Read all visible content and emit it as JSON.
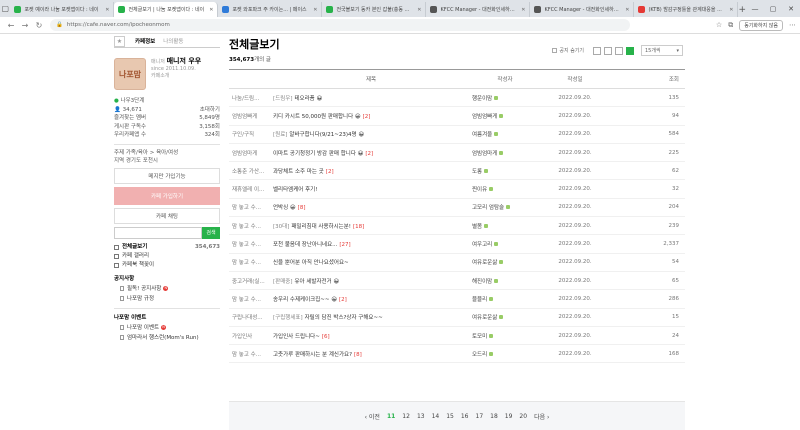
{
  "browser": {
    "tabs": [
      {
        "title": "포켓 예이라 나눔 포켓앱이다 : 네이",
        "color": "#27b24a",
        "active": false
      },
      {
        "title": "전체글보기 | 나눔 포켓앱이다 : 네이",
        "color": "#27b24a",
        "active": true
      },
      {
        "title": "포켓 와포파크 주 카이는... | 페이스",
        "color": "#2f7bd9",
        "active": false
      },
      {
        "title": "전국볼보기 동카 본인 갑불(충동 ...",
        "color": "#27b24a",
        "active": false
      },
      {
        "title": "KFCC Manager - 대전화인세하기 ...",
        "color": "#555555",
        "active": false
      },
      {
        "title": "KFCC Manager - 대전화인세하기 ...",
        "color": "#555555",
        "active": false
      },
      {
        "title": "(KTB) 밤감구정틀을 관계대응을 ...",
        "color": "#e53935",
        "active": false
      }
    ],
    "url": "https://cafe.naver.com/ipocheonmom",
    "sync_label": "동기화하지 않음"
  },
  "sidebar": {
    "tab_info": "카페정보",
    "tab_activity": "나의활동",
    "logo_text": "나포맘",
    "manager_label": "매니저",
    "manager_name": "매니저 우우",
    "since": "since 2011.10.09.",
    "cafe_intro": "카페소개",
    "grade": "나우3단계",
    "members": "34,671",
    "invite": "초대하기",
    "stats": [
      {
        "label": "즐겨찾는 멤버",
        "value": "5,849명"
      },
      {
        "label": "게시판 구독수",
        "value": "3,158회"
      },
      {
        "label": "우리카페앱 수",
        "value": "324회"
      }
    ],
    "topics": "주제 가족/육아 > 육아/여성",
    "region": "지역 경기도 포천시",
    "chat_feature": "메지만 가입기능",
    "join_button": "카페 가입하기",
    "chat_button": "카페 채팅",
    "search_button": "검색",
    "menu": [
      {
        "label": "전체글보기",
        "count": "354,673"
      },
      {
        "label": "카페 갤러리",
        "count": ""
      },
      {
        "label": "카페북 책꽂이",
        "count": ""
      }
    ],
    "notice_section": "공지사항",
    "notice_items": [
      {
        "label": "필독! 공지사항",
        "badge": true
      },
      {
        "label": "나포맘 규정",
        "badge": false
      }
    ],
    "event_section": "나포맘 이벤트",
    "event_items": [
      {
        "label": "나포맘 이벤트",
        "badge": true
      },
      {
        "label": "엄마라서 행스런(Mom's Run)",
        "badge": false
      }
    ]
  },
  "main": {
    "title": "전체글보기",
    "count": "354,673",
    "count_suffix": "개의 글",
    "notice_hide": "공지 숨기기",
    "page_size": "15개씩",
    "columns": {
      "title": "제목",
      "author": "작성자",
      "date": "작성일",
      "views": "조회"
    },
    "rows": [
      {
        "cat": "나눔/드림...",
        "tag": "[드림우]",
        "title": "테오라픔 😀",
        "cmt": "",
        "author": "행운이맘",
        "date": "2022.09.20.",
        "views": "135"
      },
      {
        "cat": "엄빔엄빠게",
        "tag": "",
        "title": "키디 카시트 50,000원 판매합니다 😀",
        "cmt": "[2]",
        "author": "엄빔엄빠게",
        "date": "2022.09.20.",
        "views": "94"
      },
      {
        "cat": "구인/구직",
        "tag": "[원료]",
        "title": "알바구합니다(9/21~23)4명 😀",
        "cmt": "",
        "author": "여름겨울",
        "date": "2022.09.20.",
        "views": "584"
      },
      {
        "cat": "엄빔엄마게",
        "tag": "",
        "title": "이마트 공기청정기 방감 판매 합니다 😀",
        "cmt": "[2]",
        "author": "엄빔엄마게",
        "date": "2022.09.20.",
        "views": "225"
      },
      {
        "cat": "소통춘 가산...",
        "tag": "",
        "title": "과당체트 소주 마는 곳",
        "cmt": "[2]",
        "author": "도롱",
        "date": "2022.09.20.",
        "views": "62"
      },
      {
        "cat": "재휴엘레 이...",
        "tag": "",
        "title": "벨리타엠케어 후기!",
        "cmt": "",
        "author": "찐이유",
        "date": "2022.09.20.",
        "views": "32"
      },
      {
        "cat": "맘 놓고 수...",
        "tag": "",
        "title": "언박싱 😀",
        "cmt": "[8]",
        "author": "고모리 엄탐술",
        "date": "2022.09.20.",
        "views": "204"
      },
      {
        "cat": "맘 놓고 수...",
        "tag": "[30대]",
        "title": "패밀리침대 사용하시는분!",
        "cmt": "[18]",
        "author": "별봄",
        "date": "2022.09.20.",
        "views": "239"
      },
      {
        "cat": "맘 놓고 수...",
        "tag": "",
        "title": "포천 불음데 장난아니네요...",
        "cmt": "[27]",
        "author": "여우고리",
        "date": "2022.09.20.",
        "views": "2,337"
      },
      {
        "cat": "맘 놓고 수...",
        "tag": "",
        "title": "신을 뿐어분 아직 안나요셨어요~",
        "cmt": "",
        "author": "여유로운삶",
        "date": "2022.09.20.",
        "views": "54"
      },
      {
        "cat": "중고거래(실...",
        "tag": "[판매중]",
        "title": "유아 세발자전거 😀",
        "cmt": "",
        "author": "해진이맘",
        "date": "2022.09.20.",
        "views": "65"
      },
      {
        "cat": "맘 놓고 수...",
        "tag": "",
        "title": "송우리 수제케이크집~~ 😀",
        "cmt": "[2]",
        "author": "블블리",
        "date": "2022.09.20.",
        "views": "286"
      },
      {
        "cat": "구립나대성...",
        "tag": "[구립행세표]",
        "title": "자릴의 담진 박스?상자 구해요~~",
        "cmt": "",
        "author": "여유로운삶",
        "date": "2022.09.20.",
        "views": "15"
      },
      {
        "cat": "가입인사",
        "tag": "",
        "title": "가입인사 드립니다~",
        "cmt": "[6]",
        "author": "토모미",
        "date": "2022.09.20.",
        "views": "24"
      },
      {
        "cat": "맘 놓고 수...",
        "tag": "",
        "title": "고춧가루 판매하시는 분 계신가요?",
        "cmt": "[8]",
        "author": "오드리",
        "date": "2022.09.20.",
        "views": "168"
      }
    ],
    "pager": {
      "prev": "이전",
      "next": "다음",
      "pages": [
        "11",
        "12",
        "13",
        "14",
        "15",
        "16",
        "17",
        "18",
        "19",
        "20"
      ],
      "current": "11"
    }
  },
  "colors": {
    "brand_green": "#27b24a",
    "join_pink": "#f1b0b0",
    "comment_red": "#e53935"
  }
}
